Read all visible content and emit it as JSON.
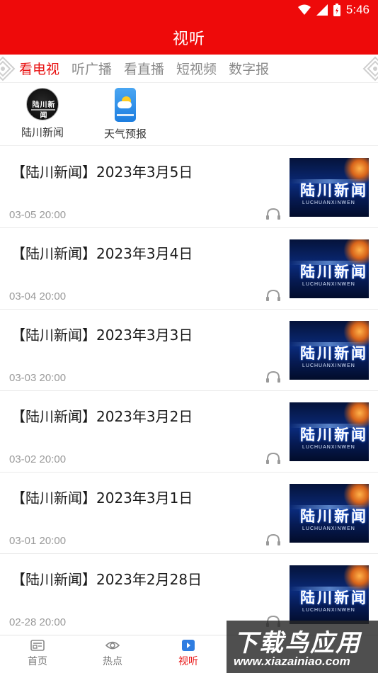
{
  "status_bar": {
    "time": "5:46"
  },
  "header": {
    "title": "视听"
  },
  "tabs": [
    {
      "label": "看电视",
      "active": true
    },
    {
      "label": "听广播",
      "active": false
    },
    {
      "label": "看直播",
      "active": false
    },
    {
      "label": "短视频",
      "active": false
    },
    {
      "label": "数字报",
      "active": false
    }
  ],
  "channels": [
    {
      "label": "陆川新闻",
      "icon": "luchuan-news-logo-icon"
    },
    {
      "label": "天气预报",
      "icon": "weather-forecast-icon"
    }
  ],
  "news": [
    {
      "title": "【陆川新闻】2023年3月5日",
      "date": "03-05 20:00"
    },
    {
      "title": "【陆川新闻】2023年3月4日",
      "date": "03-04 20:00"
    },
    {
      "title": "【陆川新闻】2023年3月3日",
      "date": "03-03 20:00"
    },
    {
      "title": "【陆川新闻】2023年3月2日",
      "date": "03-02 20:00"
    },
    {
      "title": "【陆川新闻】2023年3月1日",
      "date": "03-01 20:00"
    },
    {
      "title": "【陆川新闻】2023年2月28日",
      "date": "02-28 20:00"
    }
  ],
  "thumbnail": {
    "word": "陆川新闻",
    "sub": "LUCHUANXINWEN"
  },
  "bottom_nav": [
    {
      "label": "首页",
      "icon": "home-news-icon",
      "active": false
    },
    {
      "label": "热点",
      "icon": "eye-icon",
      "active": false
    },
    {
      "label": "视听",
      "icon": "play-icon",
      "active": true
    }
  ],
  "watermark": {
    "title": "下载鸟应用",
    "url": "www.xiazainiao.com"
  },
  "colors": {
    "brand_red": "#ee0a0a",
    "active_text": "#e81212",
    "muted_text": "#8a8a8a"
  }
}
